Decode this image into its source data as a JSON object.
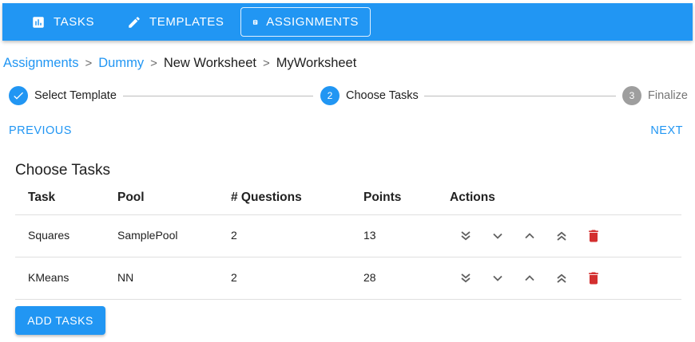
{
  "nav": {
    "tasks_label": "TASKS",
    "templates_label": "TEMPLATES",
    "assignments_label": "ASSIGNMENTS"
  },
  "breadcrumb": {
    "items": [
      "Assignments",
      "Dummy",
      "New Worksheet",
      "MyWorksheet"
    ],
    "separator": ">"
  },
  "stepper": {
    "steps": [
      {
        "number": "1",
        "label": "Select Template",
        "state": "completed"
      },
      {
        "number": "2",
        "label": "Choose Tasks",
        "state": "active"
      },
      {
        "number": "3",
        "label": "Finalize",
        "state": "pending"
      }
    ]
  },
  "navigation": {
    "previous_label": "PREVIOUS",
    "next_label": "NEXT"
  },
  "section": {
    "title": "Choose Tasks"
  },
  "table": {
    "headers": [
      "Task",
      "Pool",
      "# Questions",
      "Points",
      "Actions"
    ],
    "rows": [
      {
        "task": "Squares",
        "pool": "SamplePool",
        "questions": "2",
        "points": "13"
      },
      {
        "task": "KMeans",
        "pool": "NN",
        "questions": "2",
        "points": "28"
      }
    ],
    "action_icons": [
      "double-chevron-down-icon",
      "chevron-down-icon",
      "chevron-up-icon",
      "double-chevron-up-icon",
      "trash-icon"
    ]
  },
  "add_tasks_label": "ADD TASKS",
  "colors": {
    "primary": "#2196f3",
    "danger": "#d32f2f",
    "step_pending": "#9e9e9e"
  }
}
